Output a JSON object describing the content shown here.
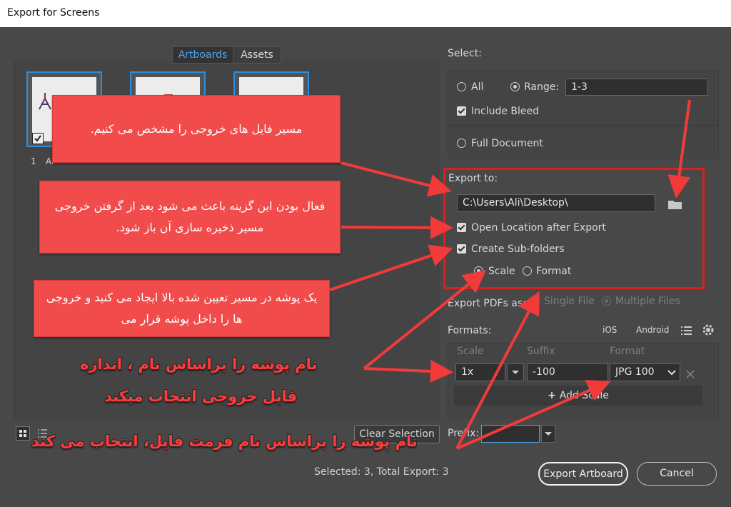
{
  "window": {
    "title": "Export for Screens"
  },
  "tabs": [
    "Artboards",
    "Assets"
  ],
  "artboards": [
    {
      "index": "1",
      "name": "Ar"
    }
  ],
  "select": {
    "label": "Select:",
    "all": "All",
    "range_label": "Range:",
    "range_value": "1-3",
    "include_bleed": "Include Bleed",
    "full_document": "Full Document"
  },
  "export_to": {
    "label": "Export to:",
    "path": "C:\\Users\\Ali\\Desktop\\",
    "open_location": "Open Location after Export",
    "create_subfolders": "Create Sub-folders",
    "scale": "Scale",
    "format": "Format"
  },
  "export_pdfs": {
    "label": "Export PDFs as:",
    "single": "Single File",
    "multiple": "Multiple Files"
  },
  "formats": {
    "label": "Formats:",
    "ios": "iOS",
    "android": "Android",
    "col_scale": "Scale",
    "col_suffix": "Suffix",
    "col_format": "Format",
    "row_scale": "1x",
    "row_suffix": "-100",
    "row_format": "JPG 100",
    "add_scale": "Add Scale"
  },
  "prefix_label": "Prefix:",
  "clear_selection": "Clear Selection",
  "status": "Selected: 3, Total Export: 3",
  "buttons": {
    "export": "Export Artboard",
    "cancel": "Cancel"
  },
  "annotations": {
    "callout1": "مسیر فایل های خروجی  را مشخص می کنیم.",
    "callout2": "فعال بودن این گزینه باعث می شود بعد از گرفتن خروجی مسیر ذخیره سازی آن باز شود.",
    "callout3": "یک پوشه در مسیر تعیین شده بالا ایجاد می کنید و خروجی ها را داخل پوشه قرار می",
    "text1a": "نام پوشه را براساس نام ، اندازه",
    "text1b": "فایل خروجی انتخاب میکند",
    "text2": "نام پوشه را براساس نام فرمت فایل، انتخاب می کند"
  },
  "colors": {
    "accent": "#2e8fde",
    "annotation": "#f24b4b",
    "highlight_box": "#d9201f"
  }
}
